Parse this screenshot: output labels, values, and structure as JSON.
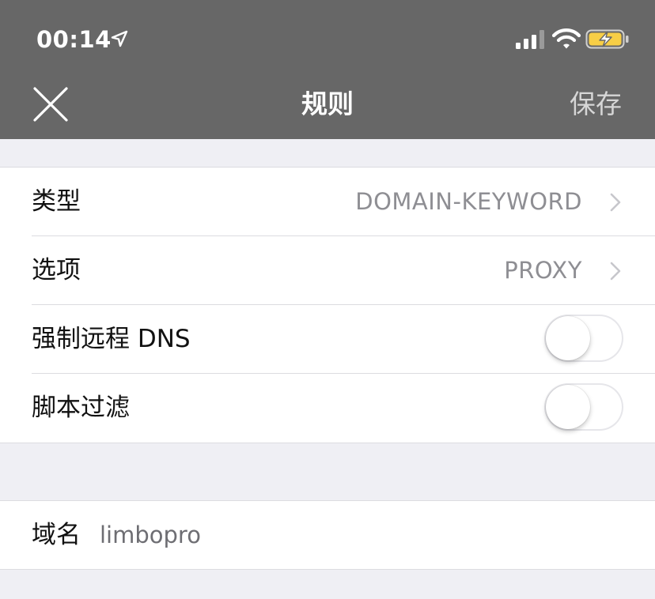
{
  "status_bar": {
    "time": "00:14",
    "icons": [
      "location-arrow-icon",
      "signal-icon",
      "wifi-icon",
      "battery-charging-icon"
    ]
  },
  "nav": {
    "title": "规则",
    "save_label": "保存",
    "close_icon": "close-icon"
  },
  "rule_settings": {
    "type_label": "类型",
    "type_value": "DOMAIN-KEYWORD",
    "option_label": "选项",
    "option_value": "PROXY",
    "force_remote_dns_label": "强制远程 DNS",
    "force_remote_dns_on": false,
    "script_filter_label": "脚本过滤",
    "script_filter_on": false
  },
  "domain": {
    "label": "域名",
    "value": "limbopro"
  },
  "colors": {
    "nav_background": "#676767",
    "page_background": "#efeff4",
    "battery_fill": "#f7ce46"
  }
}
